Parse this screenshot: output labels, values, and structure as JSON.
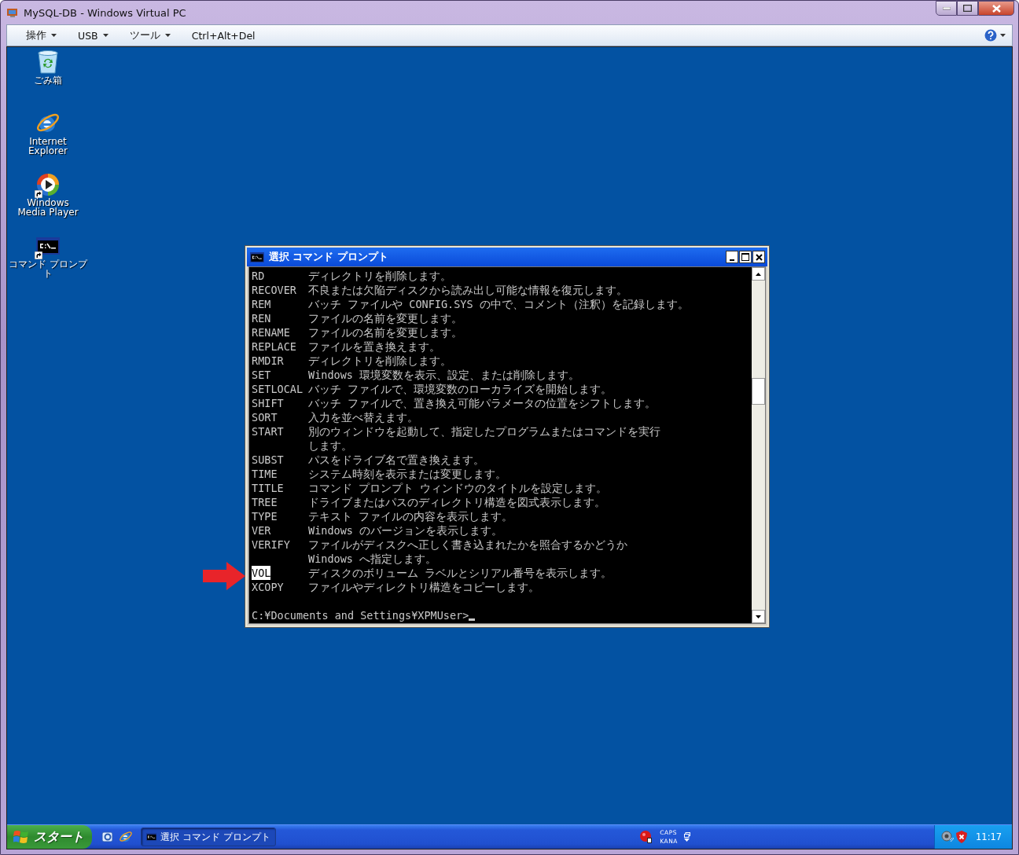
{
  "window": {
    "title": "MySQL-DB - Windows Virtual PC"
  },
  "menu": [
    {
      "label": "操作",
      "dropdown": true
    },
    {
      "label": "USB",
      "dropdown": true
    },
    {
      "label": "ツール",
      "dropdown": true
    },
    {
      "label": "Ctrl+Alt+Del",
      "dropdown": false
    }
  ],
  "desktop_icons": [
    {
      "kind": "recycle-bin",
      "shortcut": false,
      "label_lines": [
        "ごみ箱"
      ]
    },
    {
      "kind": "browser",
      "shortcut": false,
      "label_lines": [
        "Internet",
        "Explorer"
      ]
    },
    {
      "kind": "media-player",
      "shortcut": true,
      "label_lines": [
        "Windows",
        "Media Player"
      ]
    },
    {
      "kind": "console",
      "shortcut": true,
      "label_lines": [
        "コマンド プロンプ",
        "ト"
      ]
    }
  ],
  "console": {
    "title": "選択 コマンド プロンプト",
    "rows": [
      {
        "command": "RD",
        "description": [
          "ディレクトリを削除します。"
        ],
        "selected": false
      },
      {
        "command": "RECOVER",
        "description": [
          "不良または欠陥ディスクから読み出し可能な情報を復元します。"
        ],
        "selected": false
      },
      {
        "command": "REM",
        "description": [
          "バッチ ファイルや CONFIG.SYS の中で、コメント（注釈）を記録します。"
        ],
        "selected": false
      },
      {
        "command": "REN",
        "description": [
          "ファイルの名前を変更します。"
        ],
        "selected": false
      },
      {
        "command": "RENAME",
        "description": [
          "ファイルの名前を変更します。"
        ],
        "selected": false
      },
      {
        "command": "REPLACE",
        "description": [
          "ファイルを置き換えます。"
        ],
        "selected": false
      },
      {
        "command": "RMDIR",
        "description": [
          "ディレクトリを削除します。"
        ],
        "selected": false
      },
      {
        "command": "SET",
        "description": [
          "Windows 環境変数を表示、設定、または削除します。"
        ],
        "selected": false
      },
      {
        "command": "SETLOCAL",
        "description": [
          "バッチ ファイルで、環境変数のローカライズを開始します。"
        ],
        "selected": false
      },
      {
        "command": "SHIFT",
        "description": [
          "バッチ ファイルで、置き換え可能パラメータの位置をシフトします。"
        ],
        "selected": false
      },
      {
        "command": "SORT",
        "description": [
          "入力を並べ替えます。"
        ],
        "selected": false
      },
      {
        "command": "START",
        "description": [
          "別のウィンドウを起動して、指定したプログラムまたはコマンドを実行",
          "します。"
        ],
        "selected": false
      },
      {
        "command": "SUBST",
        "description": [
          "パスをドライブ名で置き換えます。"
        ],
        "selected": false
      },
      {
        "command": "TIME",
        "description": [
          "システム時刻を表示または変更します。"
        ],
        "selected": false
      },
      {
        "command": "TITLE",
        "description": [
          "コマンド プロンプト ウィンドウのタイトルを設定します。"
        ],
        "selected": false
      },
      {
        "command": "TREE",
        "description": [
          "ドライブまたはパスのディレクトリ構造を図式表示します。"
        ],
        "selected": false
      },
      {
        "command": "TYPE",
        "description": [
          "テキスト ファイルの内容を表示します。"
        ],
        "selected": false
      },
      {
        "command": "VER",
        "description": [
          "Windows のバージョンを表示します。"
        ],
        "selected": false
      },
      {
        "command": "VERIFY",
        "description": [
          "ファイルがディスクへ正しく書き込まれたかを照合するかどうか",
          "Windows へ指定します。"
        ],
        "selected": false
      },
      {
        "command": "VOL",
        "description": [
          "ディスクのボリューム ラベルとシリアル番号を表示します。"
        ],
        "selected": true
      },
      {
        "command": "XCOPY",
        "description": [
          "ファイルやディレクトリ構造をコピーします。"
        ],
        "selected": false
      }
    ],
    "prompt": "C:¥Documents and Settings¥XPMUser>"
  },
  "annotation": {
    "kind": "arrow"
  },
  "taskbar": {
    "start": "スタート",
    "quick_launch": [
      {
        "kind": "desktop"
      },
      {
        "kind": "browser"
      }
    ],
    "tasks": [
      {
        "label": "選択 コマンド プロンプト",
        "selected": true
      }
    ],
    "language_bar": [
      "CAPS",
      "KANA"
    ],
    "clock": "11:17"
  }
}
